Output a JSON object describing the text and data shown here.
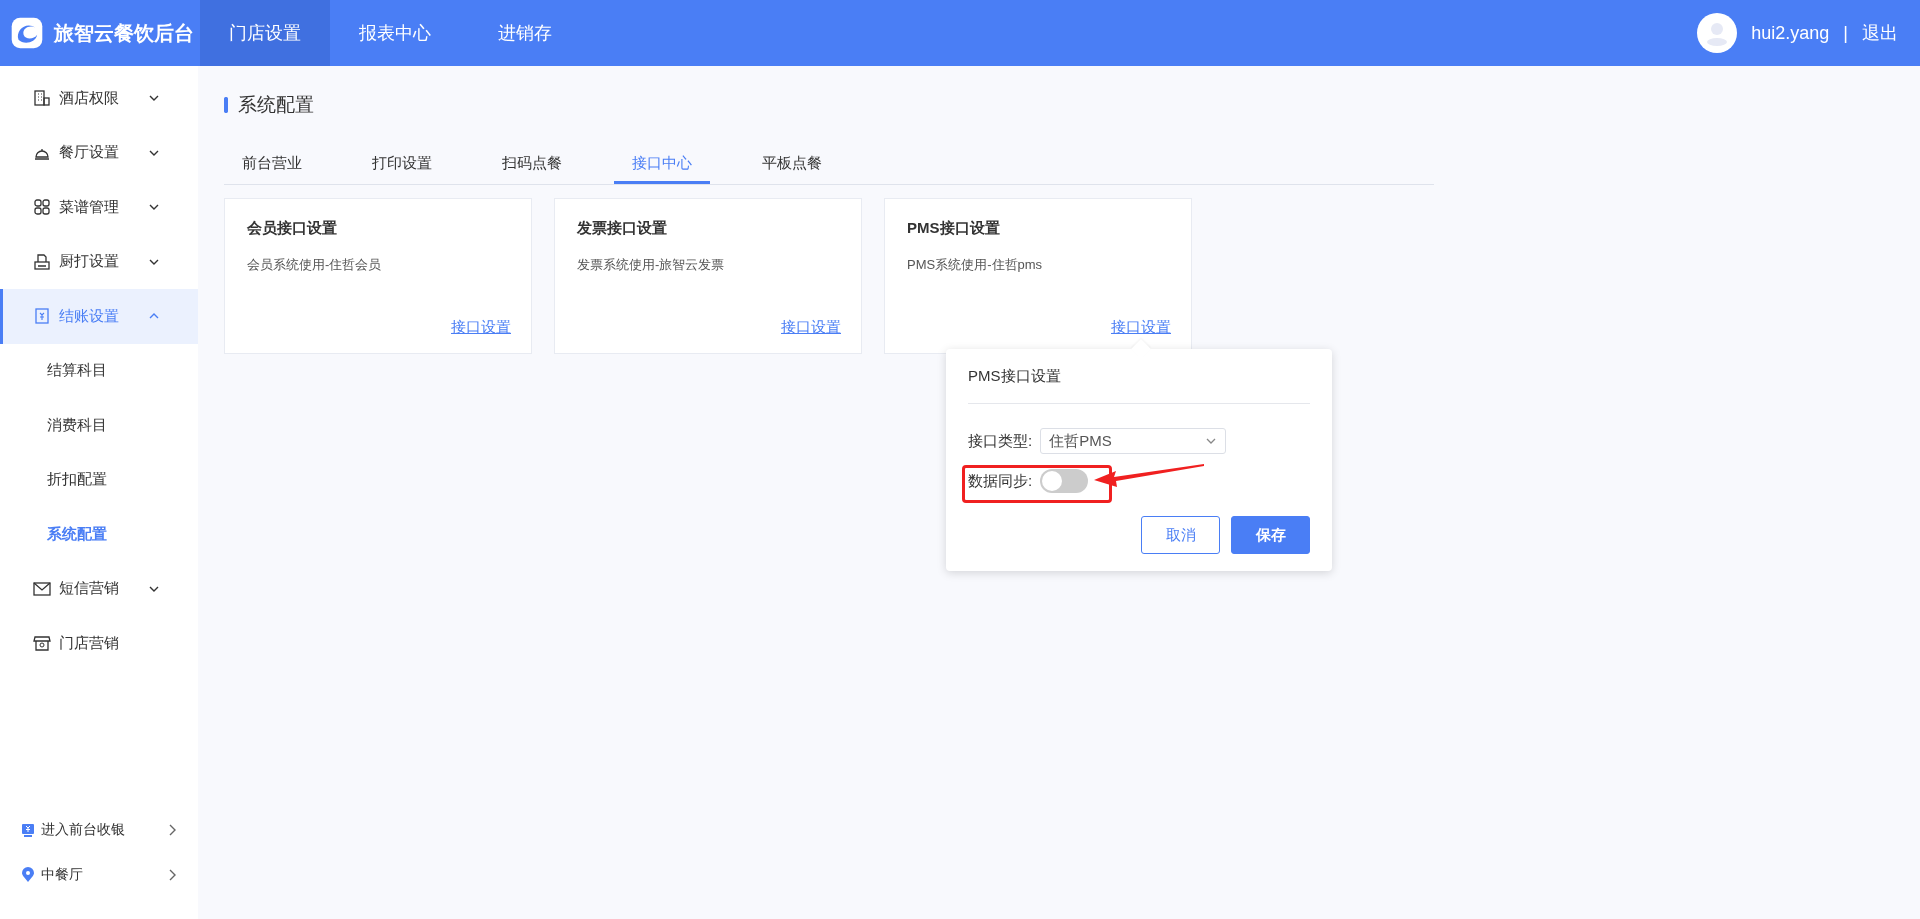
{
  "header": {
    "brand": "旅智云餐饮后台",
    "nav": [
      {
        "label": "门店设置",
        "selected": true
      },
      {
        "label": "报表中心",
        "selected": false
      },
      {
        "label": "进销存",
        "selected": false
      }
    ],
    "user": "hui2.yang",
    "separator": "|",
    "logout": "退出"
  },
  "sidebar": {
    "items": [
      {
        "label": "酒店权限",
        "expanded": false,
        "selected": false
      },
      {
        "label": "餐厅设置",
        "expanded": false,
        "selected": false
      },
      {
        "label": "菜谱管理",
        "expanded": false,
        "selected": false
      },
      {
        "label": "厨打设置",
        "expanded": false,
        "selected": false
      },
      {
        "label": "结账设置",
        "expanded": true,
        "selected": true,
        "children": [
          {
            "label": "结算科目",
            "selected": false
          },
          {
            "label": "消费科目",
            "selected": false
          },
          {
            "label": "折扣配置",
            "selected": false
          },
          {
            "label": "系统配置",
            "selected": true
          }
        ]
      },
      {
        "label": "短信营销",
        "expanded": false,
        "selected": false
      },
      {
        "label": "门店营销",
        "selected": false
      }
    ],
    "footer": [
      {
        "label": "进入前台收银"
      },
      {
        "label": "中餐厅"
      }
    ]
  },
  "page": {
    "title": "系统配置",
    "tabs": [
      {
        "label": "前台营业",
        "selected": false
      },
      {
        "label": "打印设置",
        "selected": false
      },
      {
        "label": "扫码点餐",
        "selected": false
      },
      {
        "label": "接口中心",
        "selected": true
      },
      {
        "label": "平板点餐",
        "selected": false
      }
    ],
    "cards": [
      {
        "title": "会员接口设置",
        "description": "会员系统使用-住哲会员",
        "link": "接口设置"
      },
      {
        "title": "发票接口设置",
        "description": "发票系统使用-旅智云发票",
        "link": "接口设置"
      },
      {
        "title": "PMS接口设置",
        "description": "PMS系统使用-住哲pms",
        "link": "接口设置"
      }
    ]
  },
  "popover": {
    "title": "PMS接口设置",
    "fields": [
      {
        "kind": "select",
        "label": "接口类型:",
        "value": "住哲PMS"
      },
      {
        "kind": "switch",
        "label": "数据同步:",
        "on": false
      }
    ],
    "buttons": [
      {
        "label": "取消",
        "kind": "secondary"
      },
      {
        "label": "保存",
        "kind": "primary"
      }
    ]
  }
}
